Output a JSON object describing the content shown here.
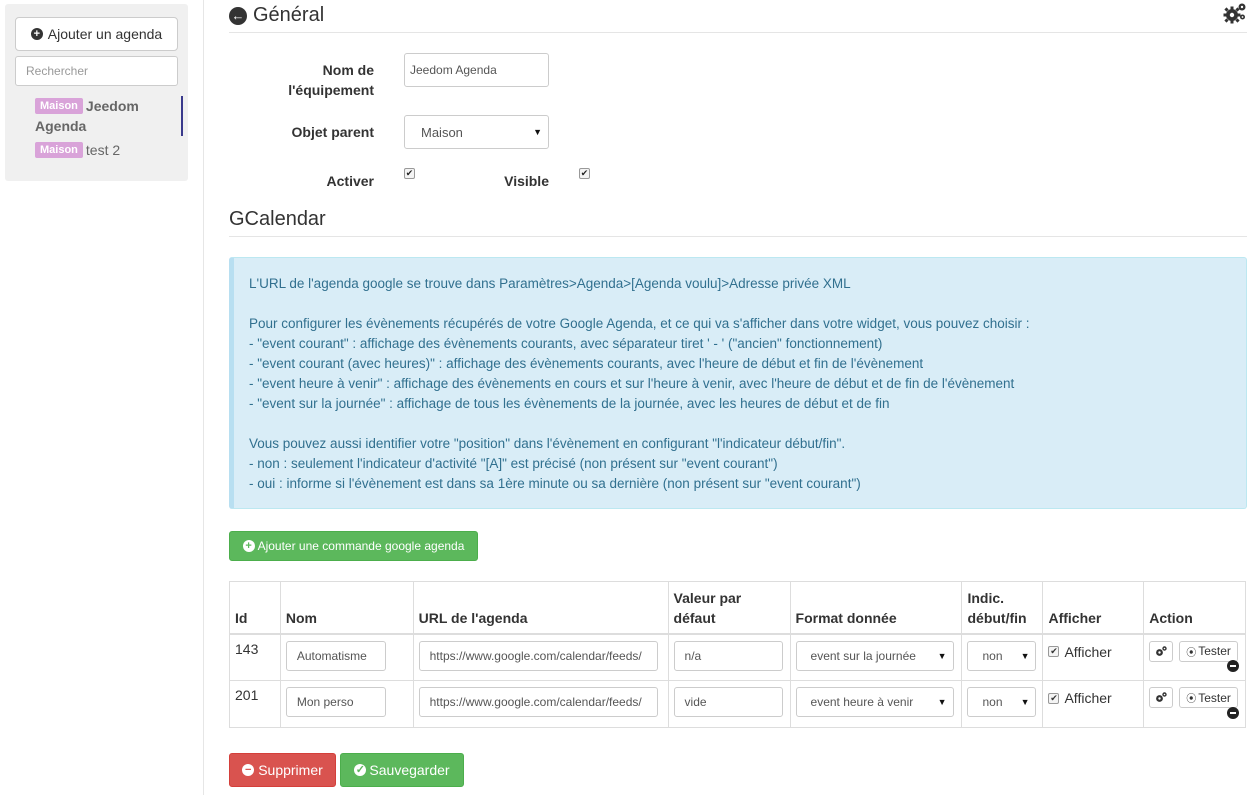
{
  "sidebar": {
    "add_button": "Ajouter un agenda",
    "search_placeholder": "Rechercher",
    "items": [
      {
        "badge": "Maison",
        "name": "Jeedom Agenda"
      },
      {
        "badge": "Maison",
        "name": "test 2"
      }
    ]
  },
  "header": {
    "title": "Général"
  },
  "form": {
    "name_label": "Nom de l'équipement",
    "name_value": "Jeedom Agenda",
    "parent_label": "Objet parent",
    "parent_value": "Maison",
    "enable_label": "Activer",
    "enable_checked": true,
    "visible_label": "Visible",
    "visible_checked": true
  },
  "gcal": {
    "title": "GCalendar",
    "info": {
      "line1": "L'URL de l'agenda google se trouve dans Paramètres>Agenda>[Agenda voulu]>Adresse privée XML",
      "line2": "Pour configurer les évènements récupérés de votre Google Agenda, et ce qui va s'afficher dans votre widget, vous pouvez choisir :",
      "line3": "- \"event courant\" : affichage des évènements courants, avec séparateur tiret ' - ' (\"ancien\" fonctionnement)",
      "line4": "- \"event courant (avec heures)\" : affichage des évènements courants, avec l'heure de début et fin de l'évènement",
      "line5": "- \"event heure à venir\" : affichage des évènements en cours et sur l'heure à venir, avec l'heure de début et de fin de l'évènement",
      "line6": "- \"event sur la journée\" : affichage de tous les évènements de la journée, avec les heures de début et de fin",
      "line7": "Vous pouvez aussi identifier votre \"position\" dans l'évènement en configurant \"l'indicateur début/fin\".",
      "line8": "- non : seulement l'indicateur d'activité \"[A]\" est précisé (non présent sur \"event courant\")",
      "line9": "- oui : informe si l'évènement est dans sa 1ère minute ou sa dernière (non présent sur \"event courant\")"
    },
    "add_command_button": "Ajouter une commande google agenda"
  },
  "table": {
    "headers": {
      "id": "Id",
      "nom": "Nom",
      "url": "URL de l'agenda",
      "valeur": "Valeur par défaut",
      "format": "Format donnée",
      "indic": "Indic. début/fin",
      "afficher": "Afficher",
      "action": "Action"
    },
    "rows": [
      {
        "id": "143",
        "nom": "Automatisme",
        "url": "https://www.google.com/calendar/feeds/",
        "valeur": "n/a",
        "format": "event sur la journée",
        "indic": "non",
        "afficher": "Afficher",
        "configure": "",
        "test": "Tester"
      },
      {
        "id": "201",
        "nom": "Mon perso",
        "url": "https://www.google.com/calendar/feeds/",
        "valeur": "vide",
        "format": "event heure à venir",
        "indic": "non",
        "afficher": "Afficher",
        "configure": "",
        "test": "Tester"
      }
    ]
  },
  "footer": {
    "delete_button": "Supprimer",
    "save_button": "Sauvegarder"
  },
  "colors": {
    "success": "#5cb85c",
    "danger": "#d9534f",
    "info_bg": "#d9edf7",
    "info_text": "#31708f",
    "badge": "#d9a3d9"
  }
}
